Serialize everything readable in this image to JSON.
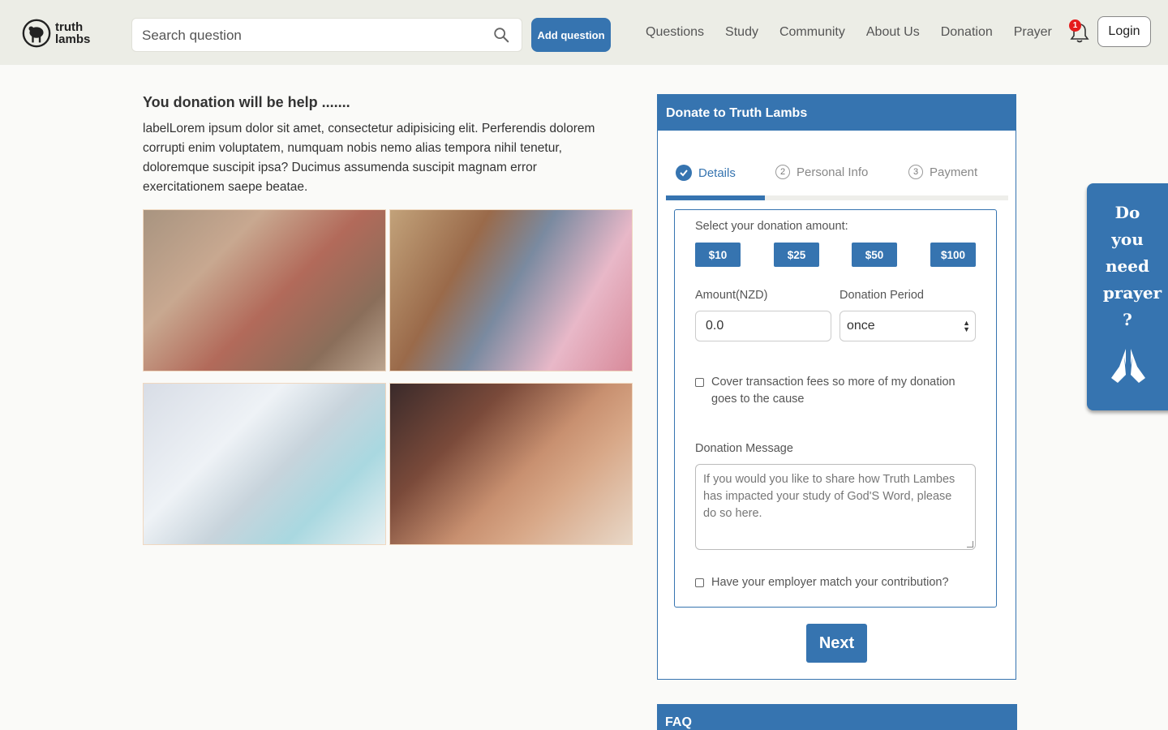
{
  "header": {
    "logo_text_line1": "truth",
    "logo_text_line2": "lambs",
    "search_placeholder": "Search question",
    "add_question_label": "Add question",
    "nav": [
      "Questions",
      "Study",
      "Community",
      "About Us",
      "Donation",
      "Prayer"
    ],
    "notification_count": "1",
    "login_label": "Login"
  },
  "intro": {
    "title": "You donation will be help .......",
    "paragraph": "labelLorem ipsum dolor sit amet, consectetur adipisicing elit. Perferendis dolorem corrupti enim voluptatem, numquam nobis nemo alias tempora nihil tenetur, doloremque suscipit ipsa? Ducimus assumenda suscipit magnam error exercitationem saepe beatae."
  },
  "donate": {
    "title": "Donate to Truth Lambs",
    "steps": [
      {
        "num": "",
        "label": "Details"
      },
      {
        "num": "2",
        "label": "Personal Info"
      },
      {
        "num": "3",
        "label": "Payment"
      }
    ],
    "progress_fraction": 0.29,
    "select_amount_label": "Select your donation amount:",
    "amounts": [
      "$10",
      "$25",
      "$50",
      "$100"
    ],
    "amount_label": "Amount(NZD)",
    "amount_value": "0.0",
    "period_label": "Donation Period",
    "period_value": "once",
    "cover_fees_label": "Cover transaction fees so more of my donation goes to the cause",
    "message_label": "Donation Message",
    "message_placeholder": "If you would you like to share how Truth Lambes has impacted your study of God'S Word, please do so here.",
    "employer_match_label": "Have your employer match your contribution?",
    "next_label": "Next"
  },
  "faq": {
    "title": "FAQ"
  },
  "prayer_tab": {
    "lines": [
      "Do",
      "you",
      "need",
      "prayer",
      "?"
    ]
  },
  "colors": {
    "brand": "#3674b0",
    "header_bg": "#ecede6",
    "badge": "#e51c1c"
  }
}
